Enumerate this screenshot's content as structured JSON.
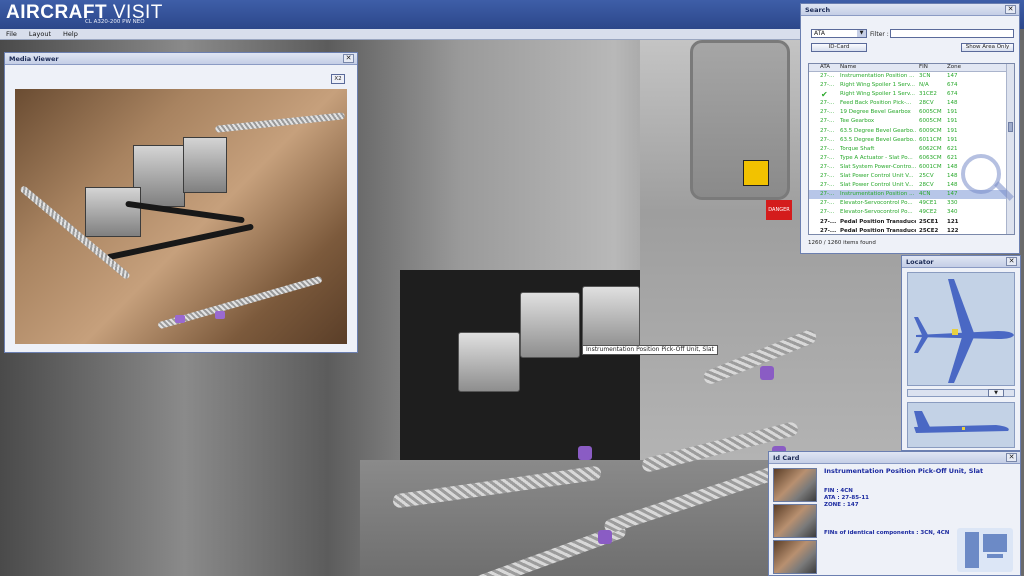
{
  "app": {
    "title_bold": "AIRCRAFT",
    "title_thin": " VISIT",
    "subtitle": "CL A320-200 PW NEO"
  },
  "menu": [
    "File",
    "Layout",
    "Help"
  ],
  "media_viewer": {
    "title": "Media Viewer",
    "close_label": "✕",
    "zoom_label": "X2"
  },
  "search": {
    "title": "Search",
    "close_label": "✕",
    "mode_selected": "ATA",
    "filter_label": "Filter :",
    "filter_value": "",
    "id_card_label": "ID-Card",
    "show_area_label": "Show Area Only",
    "columns": [
      "ATA",
      "Name",
      "FIN",
      "Zone"
    ],
    "rows": [
      {
        "ata": "27-...",
        "name": "Instrumentation Position ...",
        "fin": "3CN",
        "zone": "147"
      },
      {
        "ata": "27-...",
        "name": "Right Wing Spoiler 1 Serv...",
        "fin": "N/A",
        "zone": "674"
      },
      {
        "ata": "",
        "name": "Right Wing Spoiler 1 Serv...",
        "fin": "31CE2",
        "zone": "674"
      },
      {
        "ata": "27-...",
        "name": "Feed Back Position Pick-...",
        "fin": "28CV",
        "zone": "148"
      },
      {
        "ata": "27-...",
        "name": "19 Degree Bevel Gearbox",
        "fin": "6005CM",
        "zone": "191"
      },
      {
        "ata": "27-...",
        "name": "Tee Gearbox",
        "fin": "6005CM",
        "zone": "191"
      },
      {
        "ata": "27-...",
        "name": "63.5 Degree Bevel Gearbo...",
        "fin": "6009CM",
        "zone": "191"
      },
      {
        "ata": "27-...",
        "name": "63.5 Degree Bevel Gearbo...",
        "fin": "6011CM",
        "zone": "191"
      },
      {
        "ata": "27-...",
        "name": "Torque Shaft",
        "fin": "6062CM",
        "zone": "621"
      },
      {
        "ata": "27-...",
        "name": "Type A Actuator - Slat Po...",
        "fin": "6063CM",
        "zone": "621"
      },
      {
        "ata": "27-...",
        "name": "Slat System Power-Contro...",
        "fin": "6001CM",
        "zone": "148"
      },
      {
        "ata": "27-...",
        "name": "Slat Power Control Unit V...",
        "fin": "25CV",
        "zone": "148"
      },
      {
        "ata": "27-...",
        "name": "Slat Power Control Unit V...",
        "fin": "28CV",
        "zone": "148"
      },
      {
        "ata": "27-...",
        "name": "Instrumentation Position ...",
        "fin": "4CN",
        "zone": "147"
      },
      {
        "ata": "27-...",
        "name": "Elevator-Servocontrol Po...",
        "fin": "49CE1",
        "zone": "330"
      },
      {
        "ata": "27-...",
        "name": "Elevator-Servocontrol Po...",
        "fin": "49CE2",
        "zone": "340"
      },
      {
        "ata": "27-...",
        "name": "Pedal Position Transduce...",
        "fin": "25CE1",
        "zone": "121"
      },
      {
        "ata": "27-...",
        "name": "Pedal Position Transduce...",
        "fin": "25CE2",
        "zone": "122"
      }
    ],
    "status": "1260 / 1260 items found"
  },
  "locator": {
    "title": "Locator",
    "close_label": "✕"
  },
  "id_card": {
    "title": "Id Card",
    "name": "Instrumentation Position Pick-Off Unit, Slat",
    "fin": "FIN : 4CN",
    "ata": "ATA : 27-85-11",
    "zone": "ZONE : 147",
    "identical": "FINs of identical components : 3CN, 4CN"
  },
  "tooltip": "Instrumentation Position Pick-Off Unit, Slat",
  "scene": {
    "danger_label": "DANGER"
  },
  "colors": {
    "titlebar": "#2c478a",
    "row_text": "#27a82a",
    "selected_row": "#b7c6e8",
    "idcard_text": "#1b2aa0"
  }
}
